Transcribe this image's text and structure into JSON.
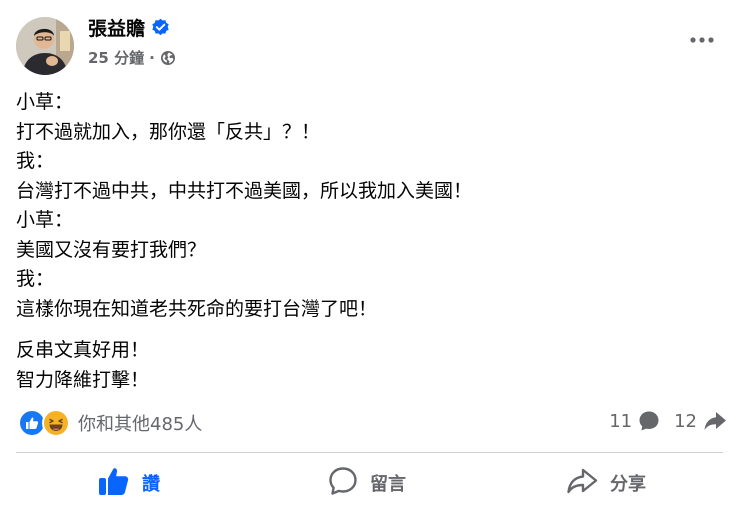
{
  "post": {
    "author": "張益贍",
    "verified": true,
    "timestamp": "25 分鐘",
    "separator": "·",
    "audience_icon": "globe-icon",
    "more_icon": "more-options-icon",
    "lines": [
      "小草：",
      "打不過就加入，那你還「反共」？！",
      "我：",
      "台灣打不過中共，中共打不過美國，所以我加入美國！",
      "小草：",
      "美國又沒有要打我們？",
      "我：",
      "這樣你現在知道老共死命的要打台灣了吧！"
    ],
    "lines2": [
      "反串文真好用！",
      "智力降維打擊！"
    ]
  },
  "reactions": {
    "icons": [
      "like-reaction-icon",
      "haha-reaction-icon"
    ],
    "summary": "你和其他485人",
    "comments_count": "11",
    "shares_count": "12"
  },
  "actions": {
    "like": "讚",
    "comment": "留言",
    "share": "分享"
  },
  "colors": {
    "like_blue": "#0866ff",
    "secondary_text": "#65676b",
    "divider": "#ced0d4",
    "haha_yellow": "#f7b125"
  }
}
